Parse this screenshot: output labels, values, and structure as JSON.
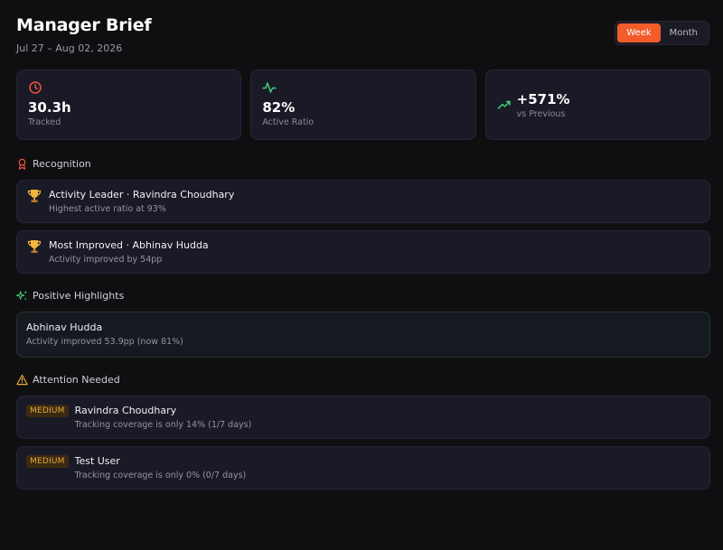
{
  "header": {
    "title": "Manager Brief",
    "date_range": "Jul 27 – Aug 02, 2026",
    "toggle": {
      "week_label": "Week",
      "month_label": "Month",
      "selected": "Week"
    }
  },
  "stats": [
    {
      "icon": "clock-icon",
      "value": "30.3h",
      "label": "Tracked",
      "color": "#f0533c"
    },
    {
      "icon": "activity-icon",
      "value": "82%",
      "label": "Active Ratio",
      "color": "#3fd07a"
    },
    {
      "icon": "trending-up-icon",
      "value": "+571%",
      "label": "vs Previous",
      "color": "#3fd07a"
    }
  ],
  "recognition": {
    "heading": "Recognition",
    "items": [
      {
        "title": "Activity Leader · Ravindra Choudhary",
        "detail": "Highest active ratio at 93%"
      },
      {
        "title": "Most Improved · Abhinav Hudda",
        "detail": "Activity improved by 54pp"
      }
    ]
  },
  "highlights": {
    "heading": "Positive Highlights",
    "items": [
      {
        "title": "Abhinav Hudda",
        "detail": "Activity improved 53.9pp (now 81%)"
      }
    ]
  },
  "attention": {
    "heading": "Attention Needed",
    "items": [
      {
        "badge": "MEDIUM",
        "title": "Ravindra Choudhary",
        "detail": "Tracking coverage is only 14% (1/7 days)"
      },
      {
        "badge": "MEDIUM",
        "title": "Test User",
        "detail": "Tracking coverage is only 0% (0/7 days)"
      }
    ]
  },
  "colors": {
    "accent": "#f25c2b",
    "warning": "#e7a93a",
    "positive": "#3fd07a",
    "danger": "#f0533c"
  }
}
